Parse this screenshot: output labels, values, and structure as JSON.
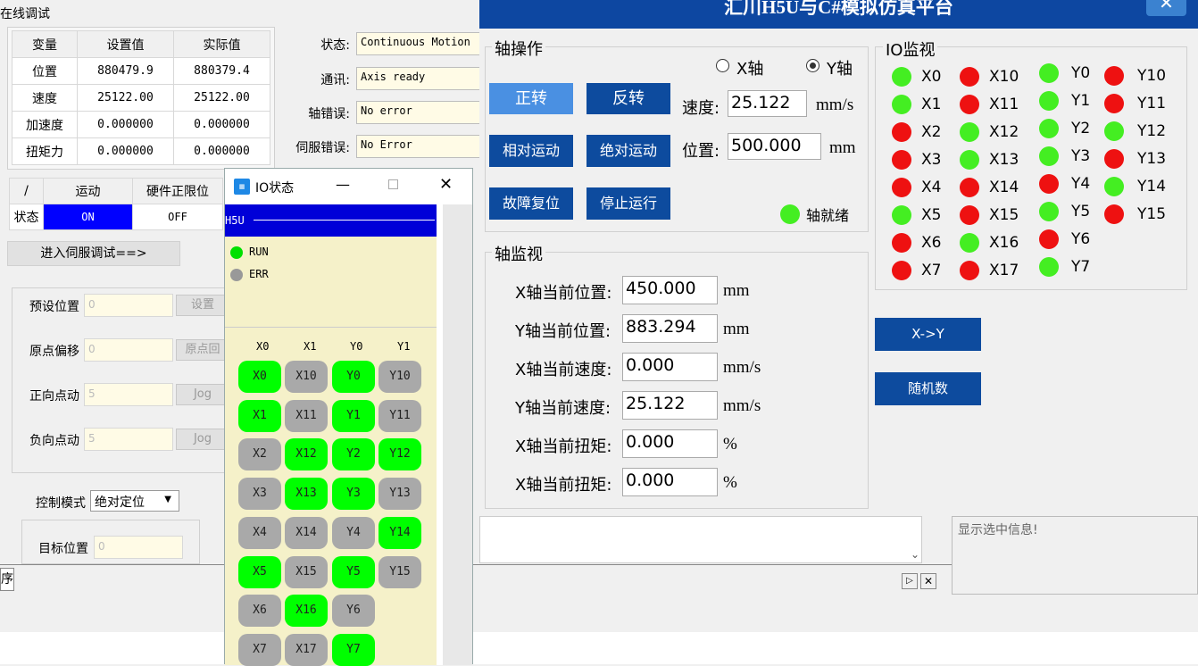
{
  "bg": {
    "title": "在线调试",
    "table": {
      "headers": [
        "变量",
        "设置值",
        "实际值"
      ],
      "rows": [
        {
          "name": "位置",
          "set": "880479.9",
          "actual": "880379.4"
        },
        {
          "name": "速度",
          "set": "25122.00",
          "actual": "25122.00"
        },
        {
          "name": "加速度",
          "set": "0.000000",
          "actual": "0.000000"
        },
        {
          "name": "扭矩力",
          "set": "0.000000",
          "actual": "0.000000"
        }
      ]
    },
    "status": [
      {
        "label": "状态:",
        "value": "Continuous Motion"
      },
      {
        "label": "通讯:",
        "value": "Axis ready"
      },
      {
        "label": "轴错误:",
        "value": "No error"
      },
      {
        "label": "伺服错误:",
        "value": "No Error"
      }
    ],
    "motion_table": {
      "headers": [
        "/",
        "运动",
        "硬件正限位"
      ],
      "row_label": "状态",
      "on": "ON",
      "off": "OFF"
    },
    "enter_servo_btn": "进入伺服调试==>",
    "fields": [
      {
        "label": "预设位置",
        "value": "0",
        "btn": "设置"
      },
      {
        "label": "原点偏移",
        "value": "0",
        "btn": "原点回"
      },
      {
        "label": "正向点动",
        "value": "5",
        "btn": "Jog"
      },
      {
        "label": "负向点动",
        "value": "5",
        "btn": "Jog"
      }
    ],
    "control_mode_label": "控制模式",
    "control_mode_value": "绝对定位",
    "target_label": "目标位置",
    "target_value": "0",
    "tab_label": "序",
    "info_text": "显示选中信息!",
    "right_edge_char": "数"
  },
  "io_window": {
    "title": "IO状态",
    "h5u_label": "H5U",
    "run_label": "RUN",
    "err_label": "ERR",
    "col_headers": [
      "X0",
      "X1",
      "Y0",
      "Y1"
    ],
    "buttons": [
      [
        {
          "t": "X0",
          "on": true
        },
        {
          "t": "X10",
          "on": false
        },
        {
          "t": "Y0",
          "on": true
        },
        {
          "t": "Y10",
          "on": false
        }
      ],
      [
        {
          "t": "X1",
          "on": true
        },
        {
          "t": "X11",
          "on": false
        },
        {
          "t": "Y1",
          "on": true
        },
        {
          "t": "Y11",
          "on": false
        }
      ],
      [
        {
          "t": "X2",
          "on": false
        },
        {
          "t": "X12",
          "on": true
        },
        {
          "t": "Y2",
          "on": true
        },
        {
          "t": "Y12",
          "on": true
        }
      ],
      [
        {
          "t": "X3",
          "on": false
        },
        {
          "t": "X13",
          "on": true
        },
        {
          "t": "Y3",
          "on": true
        },
        {
          "t": "Y13",
          "on": false
        }
      ],
      [
        {
          "t": "X4",
          "on": false
        },
        {
          "t": "X14",
          "on": false
        },
        {
          "t": "Y4",
          "on": false
        },
        {
          "t": "Y14",
          "on": true
        }
      ],
      [
        {
          "t": "X5",
          "on": true
        },
        {
          "t": "X15",
          "on": false
        },
        {
          "t": "Y5",
          "on": true
        },
        {
          "t": "Y15",
          "on": false
        }
      ],
      [
        {
          "t": "X6",
          "on": false
        },
        {
          "t": "X16",
          "on": true
        },
        {
          "t": "Y6",
          "on": false
        },
        null
      ],
      [
        {
          "t": "X7",
          "on": false
        },
        {
          "t": "X17",
          "on": false
        },
        {
          "t": "Y7",
          "on": true
        },
        null
      ]
    ]
  },
  "main": {
    "title": "汇川H5U与C#模拟仿真平台",
    "axis_op": {
      "group_label": "轴操作",
      "radio_x": "X轴",
      "radio_y": "Y轴",
      "selected": "Y",
      "btn_forward": "正转",
      "btn_reverse": "反转",
      "btn_relative": "相对运动",
      "btn_absolute": "绝对运动",
      "btn_reset": "故障复位",
      "btn_stop": "停止运行",
      "speed_label": "速度:",
      "speed_value": "25.122",
      "speed_unit": "mm/s",
      "pos_label": "位置:",
      "pos_value": "500.000",
      "pos_unit": "mm",
      "ready_label": "轴就绪"
    },
    "axis_monitor": {
      "group_label": "轴监视",
      "rows": [
        {
          "label": "X轴当前位置:",
          "value": "450.000",
          "unit": "mm"
        },
        {
          "label": "Y轴当前位置:",
          "value": "883.294",
          "unit": "mm"
        },
        {
          "label": "X轴当前速度:",
          "value": "0.000",
          "unit": "mm/s"
        },
        {
          "label": "Y轴当前速度:",
          "value": "25.122",
          "unit": "mm/s"
        },
        {
          "label": "X轴当前扭矩:",
          "value": "0.000",
          "unit": "%"
        },
        {
          "label": "X轴当前扭矩:",
          "value": "0.000",
          "unit": "%"
        }
      ]
    },
    "io_monitor": {
      "group_label": "IO监视",
      "columns": [
        [
          {
            "t": "X0",
            "on": true
          },
          {
            "t": "X1",
            "on": true
          },
          {
            "t": "X2",
            "on": false
          },
          {
            "t": "X3",
            "on": false
          },
          {
            "t": "X4",
            "on": false
          },
          {
            "t": "X5",
            "on": true
          },
          {
            "t": "X6",
            "on": false
          },
          {
            "t": "X7",
            "on": false
          }
        ],
        [
          {
            "t": "X10",
            "on": false
          },
          {
            "t": "X11",
            "on": false
          },
          {
            "t": "X12",
            "on": true
          },
          {
            "t": "X13",
            "on": true
          },
          {
            "t": "X14",
            "on": false
          },
          {
            "t": "X15",
            "on": false
          },
          {
            "t": "X16",
            "on": true
          },
          {
            "t": "X17",
            "on": false
          }
        ],
        [
          {
            "t": "Y0",
            "on": true
          },
          {
            "t": "Y1",
            "on": true
          },
          {
            "t": "Y2",
            "on": true
          },
          {
            "t": "Y3",
            "on": true
          },
          {
            "t": "Y4",
            "on": false
          },
          {
            "t": "Y5",
            "on": true
          },
          {
            "t": "Y6",
            "on": false
          },
          {
            "t": "Y7",
            "on": true
          }
        ],
        [
          {
            "t": "Y10",
            "on": false
          },
          {
            "t": "Y11",
            "on": false
          },
          {
            "t": "Y12",
            "on": true
          },
          {
            "t": "Y13",
            "on": false
          },
          {
            "t": "Y14",
            "on": true
          },
          {
            "t": "Y15",
            "on": false
          }
        ]
      ]
    },
    "btn_xy": "X->Y",
    "btn_random": "随机数"
  }
}
